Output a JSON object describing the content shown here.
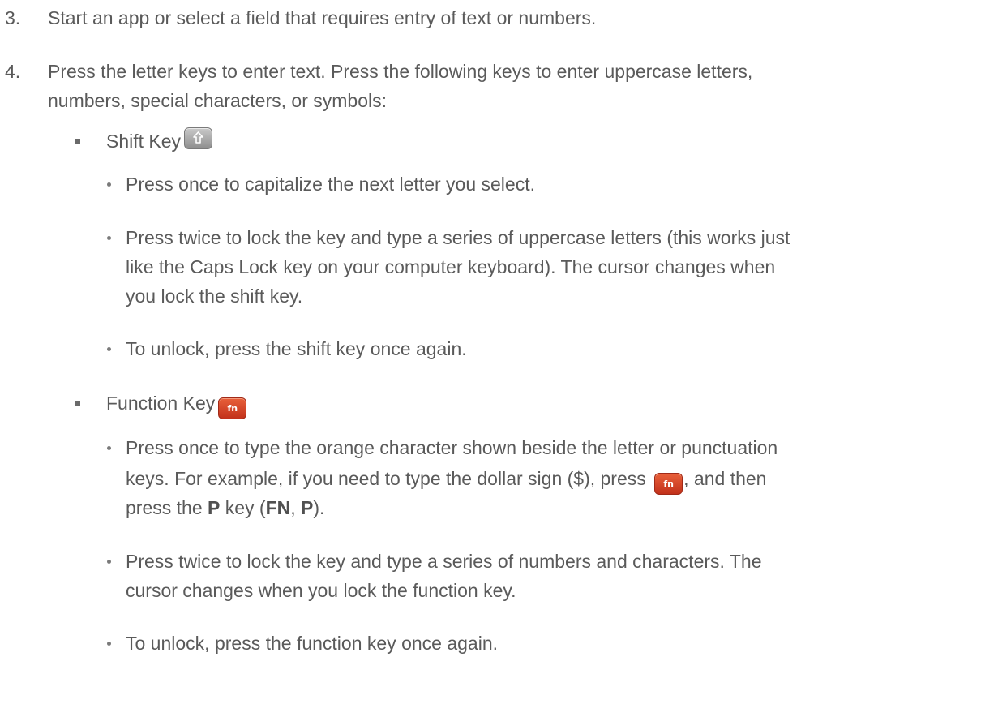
{
  "steps": [
    {
      "number": "3.",
      "lines": [
        "Start an app or select a field that requires entry of text or numbers."
      ]
    },
    {
      "number": "4.",
      "lines": [
        "Press the letter keys to enter text. Press the following keys to enter uppercase letters,",
        "numbers, special characters, or symbols:"
      ]
    }
  ],
  "shift_section": {
    "heading": "Shift Key",
    "key_icon": "shift-arrow-icon",
    "bullets": [
      {
        "lines": [
          "Press once to capitalize the next letter you select."
        ]
      },
      {
        "lines": [
          "Press twice to lock the key and type a series of uppercase letters (this works just",
          "like the Caps Lock key on your computer keyboard). The cursor changes when",
          "you lock the shift key."
        ]
      },
      {
        "lines": [
          "To unlock, press the shift key once again."
        ]
      }
    ]
  },
  "function_section": {
    "heading": "Function Key",
    "key_label": "fn",
    "key_icon": "fn-key-icon",
    "bullets": [
      {
        "line1": "Press once to type the orange character shown beside the letter or punctuation",
        "line2_before": "keys. For example, if you need to type the dollar sign ($), press",
        "line2_after": ", and then",
        "line3_a": "press the ",
        "line3_b": "P",
        "line3_c": " key (",
        "line3_d": "FN",
        "line3_e": ", ",
        "line3_f": "P",
        "line3_g": ")."
      },
      {
        "lines": [
          "Press twice to lock the key and type a series of numbers and characters. The",
          "cursor changes when you lock the function key."
        ]
      },
      {
        "lines": [
          "To unlock, press the function key once again."
        ]
      }
    ]
  },
  "colors": {
    "text": "#5a5a5a",
    "fn_key": "#d84a2b",
    "shift_key": "#a9a9a9"
  }
}
